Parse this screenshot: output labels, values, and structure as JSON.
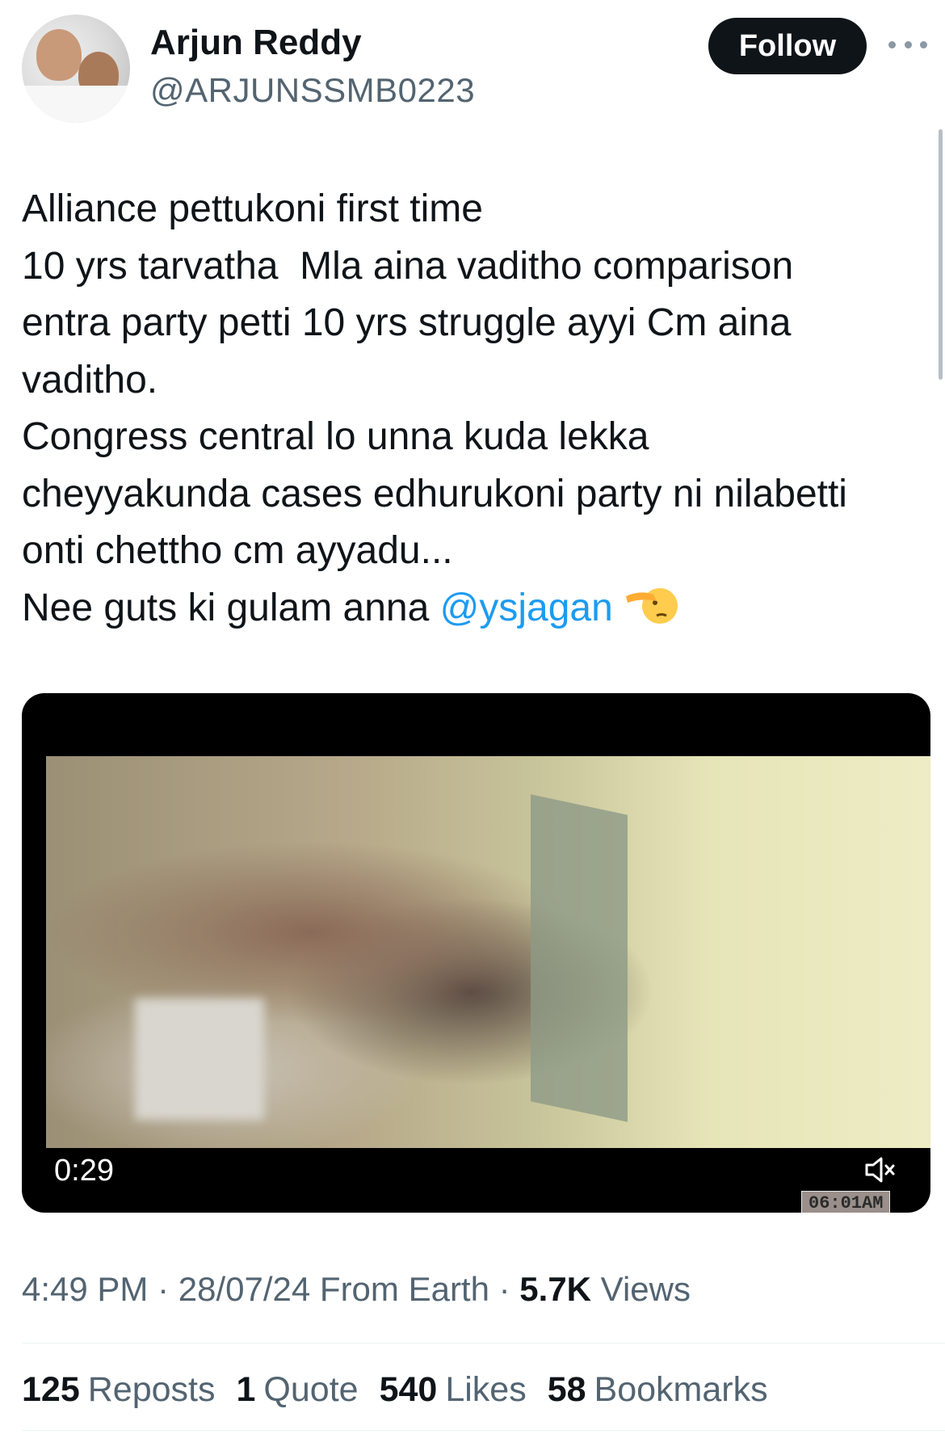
{
  "author": {
    "name": "Arjun Reddy",
    "handle": "@ARJUNSSMB0223"
  },
  "actions": {
    "follow_label": "Follow",
    "more_icon": "more-horizontal-icon"
  },
  "tweet": {
    "lines": [
      "Alliance pettukoni first time",
      "10 yrs tarvatha  Mla aina vaditho comparison",
      "entra party petti 10 yrs struggle ayyi Cm aina",
      "vaditho.",
      "Congress central lo unna kuda lekka",
      "cheyyakunda cases edhurukoni party ni nilabetti",
      "onti chettho cm ayyadu...",
      "Nee guts ki gulam anna "
    ],
    "mention": "@ysjagan",
    "emoji_icon": "saluting-face-icon"
  },
  "media": {
    "overlay_time": "06:01AM",
    "duration": "0:29",
    "mute_icon": "volume-muted-icon"
  },
  "meta": {
    "time": "4:49 PM",
    "separator": " · ",
    "date": "28/07/24",
    "source": " From Earth",
    "views_count": "5.7K",
    "views_label": " Views"
  },
  "stats": {
    "reposts_count": "125",
    "reposts_label": "Reposts",
    "quotes_count": "1",
    "quotes_label": "Quote",
    "likes_count": "540",
    "likes_label": "Likes",
    "bookmarks_count": "58",
    "bookmarks_label": "Bookmarks"
  }
}
